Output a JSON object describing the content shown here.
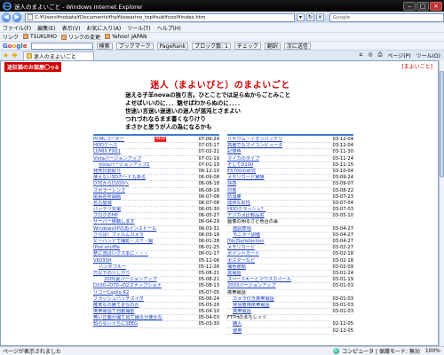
{
  "window": {
    "title": "迷人のまよいごと - Windows Internet Explorer"
  },
  "address": {
    "url": "C:¥Users¥nobata¥Documents¥hp¥kowarino_top¥sub¥cool¥index.htm"
  },
  "search": {
    "placeholder": "Google"
  },
  "menubar": [
    "ファイル(F)",
    "編集(E)",
    "表示(V)",
    "お気に入り(A)",
    "ツール(T)",
    "ヘルプ(H)"
  ],
  "links": {
    "label": "リンク",
    "items": [
      "TSUKUMO",
      "リンクの変更",
      "Yahoo! JAPAN"
    ]
  },
  "google": {
    "label": "Google",
    "items": [
      "検索",
      "ブックマーク",
      "PageRank",
      "ブロック数: 1",
      "チェック",
      "翻訳",
      "次に送信"
    ]
  },
  "tab": {
    "label": "迷人のまよいごと",
    "tools": [
      "ページ(P)",
      "ツール(O)"
    ]
  },
  "page": {
    "banner": "迷狂猫のお部屋〇ゥδ",
    "top_right": "[まよいごと]",
    "title": "迷人（まよいびと）のまよいごと",
    "intro": [
      "迷える子羊novaの独り言。ひとことでは足らぬからごとみこと",
      "よせばいいのに．．．魅せばわからぬのに．．．．",
      "世迷い言迷い迷迷いの迷人が混沌とさまよい",
      "つれづれなるまま書くなりけり",
      "まさかと思うが人の為になるかも"
    ]
  },
  "left_list": [
    {
      "t": "PCMLコーダー",
      "d": "07-06-24",
      "new": "NEW"
    },
    {
      "t": "HDDケース",
      "d": "07-03-17"
    },
    {
      "t": "LUMIX FX01",
      "d": "07-02-21"
    },
    {
      "t": "Vistaバージョンアップ",
      "d": "07-01-19"
    },
    {
      "t": "Vistaバージョンアップ2",
      "d": "07-01-19",
      "indent": 1
    },
    {
      "t": "発売日前取り",
      "d": "06-12-10"
    },
    {
      "t": "使えないSDカードもある",
      "d": "06-09-08"
    },
    {
      "t": "D70からD200へ",
      "d": "06-08-18"
    },
    {
      "t": "ズボラーレンズ",
      "d": "06-08-18"
    },
    {
      "t": "尾張名所図絵",
      "d": "06-07-08"
    },
    {
      "t": "名古屋城",
      "d": "06-07-08"
    },
    {
      "t": "バッテリ充電",
      "d": "06-05-30"
    },
    {
      "t": "ブログのHP",
      "d": "06-05-27"
    },
    {
      "t": "サーバー移籍します",
      "d": "06-04-29"
    },
    {
      "t": "WindowsXPの再インストール",
      "d": "06-03-31"
    },
    {
      "t": "さらば！フィルムカメラ",
      "d": "06-03-18"
    },
    {
      "t": "ビーハンドで撮影・ステ・解",
      "d": "06-01-28"
    },
    {
      "t": "iPod shuffle",
      "d": "06-01-25"
    },
    {
      "t": "祭に流ばいクス本に・・・",
      "d": "06-01-17"
    },
    {
      "t": "V603SH",
      "d": "05-12-06"
    },
    {
      "t": "ハンダブルー",
      "d": "05-11-26",
      "indent": 1
    },
    {
      "t": "万以下の少しやり",
      "d": "05-08-21"
    },
    {
      "t": "2005夏バージョンアップ",
      "d": "05-08-21",
      "indent": 2
    },
    {
      "t": "D100→D70→D2スナップショナ",
      "d": "05-08-13"
    },
    {
      "t": "リコーCaplio R2",
      "d": "05-07-05"
    },
    {
      "t": "フラッシュパッチスイダ",
      "d": "05-06-24"
    },
    {
      "t": "確率なの勝てまなのか",
      "d": "05-05-20"
    },
    {
      "t": "携帯電話で自動撮影",
      "d": "05-04-10"
    },
    {
      "t": "無い正面が撮て出て撮る分使かな",
      "d": "05-04-03"
    },
    {
      "t": "知らないうちにSEEG",
      "d": "05-03-30"
    }
  ],
  "right_list": [
    {
      "t": "リサウム・イオンバッテリ",
      "d": "03-12-04"
    },
    {
      "t": "高度でもマイコンピュータ",
      "d": "03-12-04"
    },
    {
      "t": "記憶色",
      "d": "03-11-30"
    },
    {
      "t": "マイカのタイプ",
      "d": "03-11-24"
    },
    {
      "t": "そしてD100",
      "d": "03-11-15"
    },
    {
      "t": "E5700の研究",
      "d": "03-10-04"
    },
    {
      "t": "メモリカード実験",
      "d": "03-09-24"
    },
    {
      "t": "快感",
      "d": "03-09-07"
    },
    {
      "t": "印象",
      "d": "03-08-22"
    },
    {
      "t": "防湿庫",
      "d": "03-07-23"
    },
    {
      "t": "成熟な彩性",
      "d": "03-07-04"
    },
    {
      "t": "HDDクラッシュ？",
      "d": "03-07-03"
    },
    {
      "t": "デジカメ比較品名",
      "d": "03-05-10"
    },
    {
      "t": "画像の明るさと色合の事",
      "d": "",
      "plain": true
    },
    {
      "t": "階調表現",
      "d": "03-04-27",
      "indent": 1
    },
    {
      "t": "モニター調整",
      "d": "03-04-27",
      "indent": 1
    },
    {
      "t": "[No]Satisfaction",
      "d": "03-04-27"
    },
    {
      "t": "メモリカード",
      "d": "03-02-27"
    },
    {
      "t": "ポイントカード",
      "d": "03-02-18"
    },
    {
      "t": "ボスターなど",
      "d": "03-02-18"
    },
    {
      "t": "補色書類",
      "d": "03-02-09"
    },
    {
      "t": "黒電話",
      "d": "03-01-24"
    },
    {
      "t": "スペースキーとマウスホイール",
      "d": "03-01-19"
    },
    {
      "t": "2003バージョンアップ",
      "d": "03-01-03"
    },
    {
      "t": "携帯電話",
      "d": "",
      "plain": true
    },
    {
      "t": "カメラ付き携帯電話",
      "d": "03-01-03",
      "indent": 1
    },
    {
      "t": "発信着用携帯電話",
      "d": "03-01-03",
      "indent": 1
    },
    {
      "t": "携帯電話",
      "d": "03-01-03",
      "indent": 1
    },
    {
      "t": "FTTHのまちレッツ",
      "d": "",
      "plain": true
    },
    {
      "t": "購入",
      "d": "02-12-05",
      "indent": 1
    },
    {
      "t": "使用",
      "d": "02-12-05",
      "indent": 1
    }
  ],
  "status": {
    "left": "ページが表示されました",
    "zone": "コンピュータ | 保護モード: 無効",
    "zoom": "100%"
  }
}
